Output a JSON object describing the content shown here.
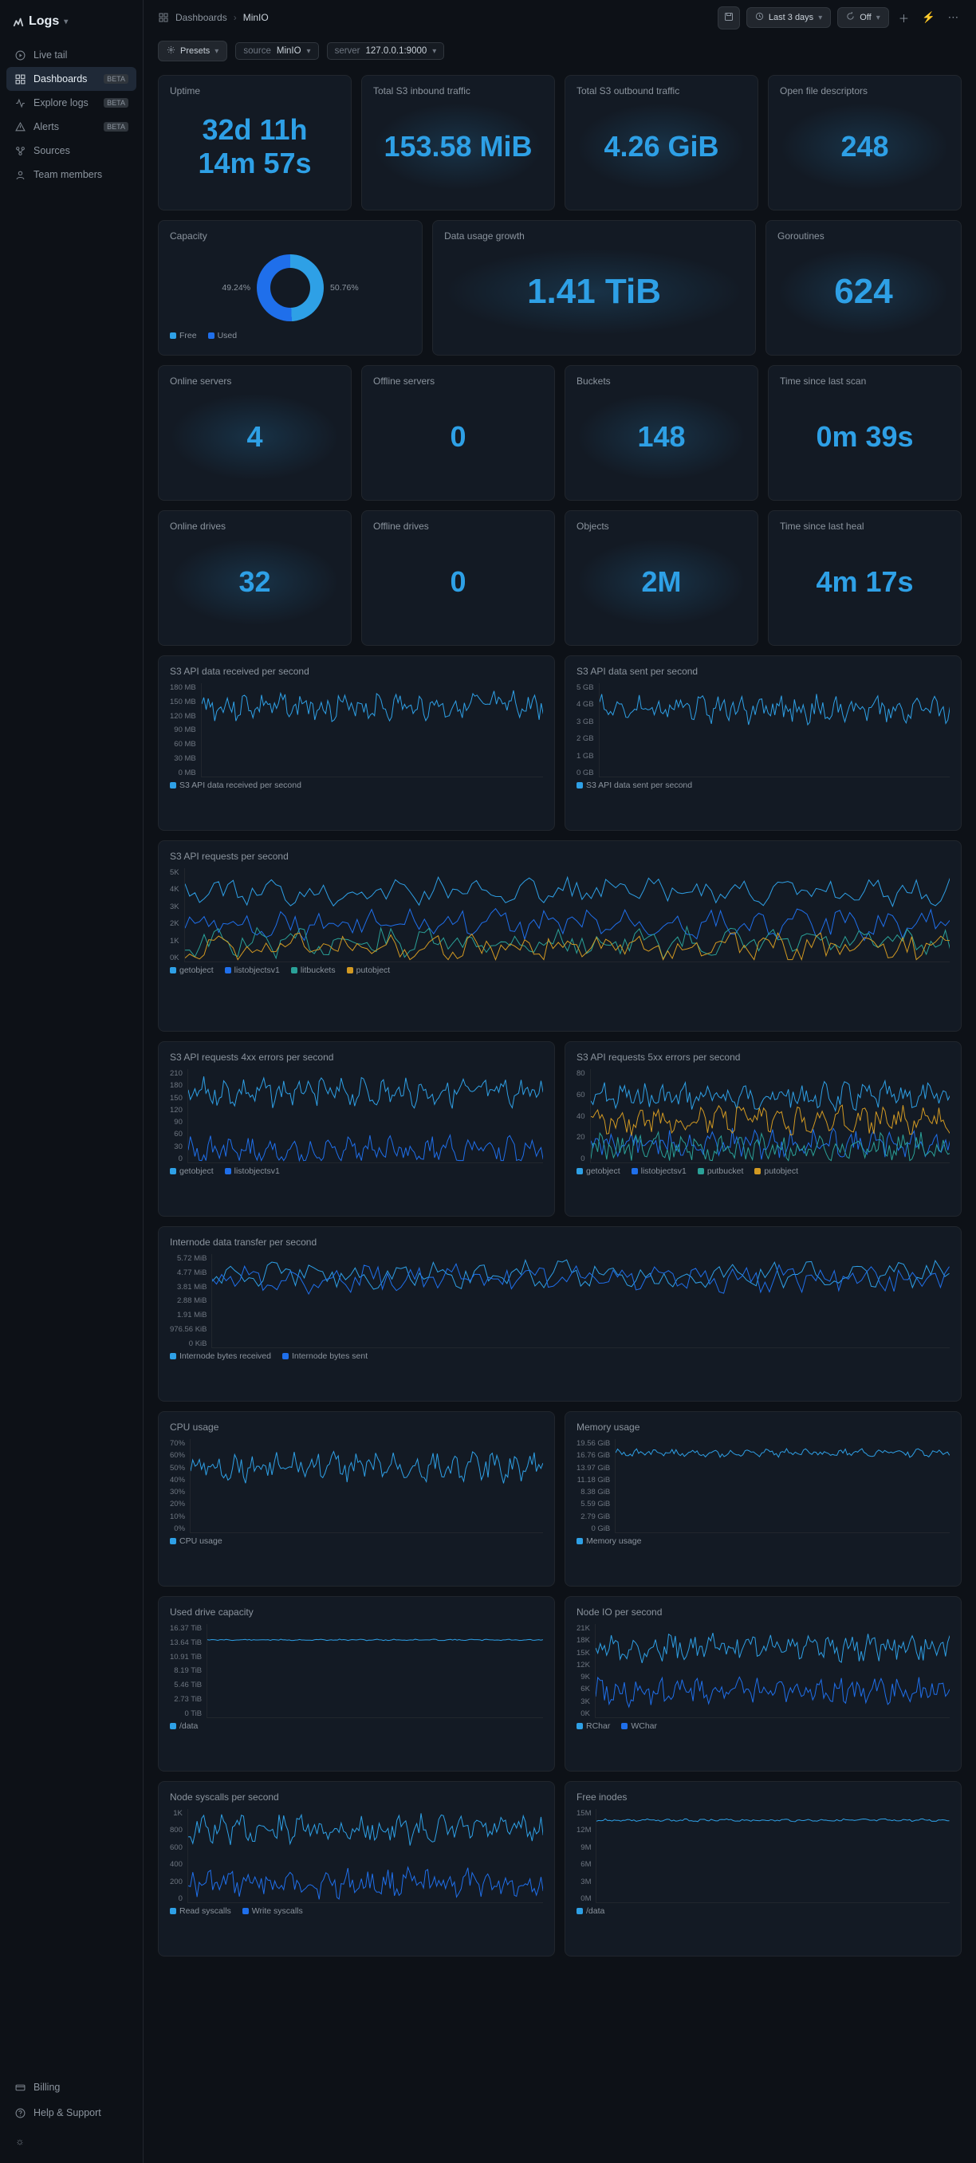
{
  "app": {
    "name": "Logs"
  },
  "sidebar": {
    "items": [
      {
        "label": "Live tail",
        "icon": "play-icon"
      },
      {
        "label": "Dashboards",
        "icon": "grid-icon",
        "badge": "BETA",
        "active": true
      },
      {
        "label": "Explore logs",
        "icon": "activity-icon",
        "badge": "BETA"
      },
      {
        "label": "Alerts",
        "icon": "alert-icon",
        "badge": "BETA"
      },
      {
        "label": "Sources",
        "icon": "sources-icon"
      },
      {
        "label": "Team members",
        "icon": "users-icon"
      }
    ],
    "bottom": [
      {
        "label": "Billing",
        "icon": "card-icon"
      },
      {
        "label": "Help & Support",
        "icon": "help-icon"
      }
    ]
  },
  "breadcrumb": {
    "icon_label": "Dashboards",
    "items": [
      "Dashboards",
      "MinIO"
    ]
  },
  "topbar": {
    "timerange": "Last 3 days",
    "refresh": "Off"
  },
  "filterbar": {
    "presets_label": "Presets",
    "source": {
      "key": "source",
      "value": "MinIO"
    },
    "server": {
      "key": "server",
      "value": "127.0.0.1:9000"
    }
  },
  "metrics_row1": [
    {
      "title": "Uptime",
      "value": "32d 11h 14m 57s",
      "bg": false
    },
    {
      "title": "Total S3 inbound traffic",
      "value": "153.58 MiB",
      "bg": true
    },
    {
      "title": "Total S3 outbound traffic",
      "value": "4.26 GiB",
      "bg": true
    },
    {
      "title": "Open file descriptors",
      "value": "248",
      "bg": true
    }
  ],
  "capacity": {
    "title": "Capacity",
    "left_pct": "49.24%",
    "right_pct": "50.76%",
    "legend": [
      {
        "label": "Free",
        "color": "#2ea0e6"
      },
      {
        "label": "Used",
        "color": "#1f6feb"
      }
    ]
  },
  "data_usage": {
    "title": "Data usage growth",
    "value": "1.41 TiB"
  },
  "goroutines": {
    "title": "Goroutines",
    "value": "624"
  },
  "metrics_row3": [
    {
      "title": "Online servers",
      "value": "4",
      "bg": true
    },
    {
      "title": "Offline servers",
      "value": "0",
      "bg": false
    },
    {
      "title": "Buckets",
      "value": "148",
      "bg": true
    },
    {
      "title": "Time since last scan",
      "value": "0m 39s",
      "bg": false
    }
  ],
  "metrics_row4": [
    {
      "title": "Online drives",
      "value": "32",
      "bg": true
    },
    {
      "title": "Offline drives",
      "value": "0",
      "bg": false
    },
    {
      "title": "Objects",
      "value": "2M",
      "bg": true
    },
    {
      "title": "Time since last heal",
      "value": "4m 17s",
      "bg": false
    }
  ],
  "charts": {
    "s3_received": {
      "title": "S3 API data received per second",
      "yticks": [
        "180 MB",
        "150 MB",
        "120 MB",
        "90 MB",
        "60 MB",
        "30 MB",
        "0 MB"
      ],
      "legend": [
        {
          "label": "S3 API data received per second",
          "color": "#2ea0e6"
        }
      ]
    },
    "s3_sent": {
      "title": "S3 API data sent per second",
      "yticks": [
        "5 GB",
        "4 GB",
        "3 GB",
        "2 GB",
        "1 GB",
        "0 GB"
      ],
      "legend": [
        {
          "label": "S3 API data sent per second",
          "color": "#2ea0e6"
        }
      ]
    },
    "s3_requests": {
      "title": "S3 API requests per second",
      "yticks": [
        "5K",
        "4K",
        "3K",
        "2K",
        "1K",
        "0K"
      ],
      "legend": [
        {
          "label": "getobject",
          "color": "#2ea0e6"
        },
        {
          "label": "listobjectsv1",
          "color": "#1f6feb"
        },
        {
          "label": "litbuckets",
          "color": "#2aa198"
        },
        {
          "label": "putobject",
          "color": "#d29922"
        }
      ]
    },
    "errors4xx": {
      "title": "S3 API requests 4xx errors per second",
      "yticks": [
        "210",
        "180",
        "150",
        "120",
        "90",
        "60",
        "30",
        "0"
      ],
      "legend": [
        {
          "label": "getobject",
          "color": "#2ea0e6"
        },
        {
          "label": "listobjectsv1",
          "color": "#1f6feb"
        }
      ]
    },
    "errors5xx": {
      "title": "S3 API requests 5xx errors per second",
      "yticks": [
        "80",
        "60",
        "40",
        "20",
        "0"
      ],
      "legend": [
        {
          "label": "getobject",
          "color": "#2ea0e6"
        },
        {
          "label": "listobjectsv1",
          "color": "#1f6feb"
        },
        {
          "label": "putbucket",
          "color": "#2aa198"
        },
        {
          "label": "putobject",
          "color": "#d29922"
        }
      ]
    },
    "internode": {
      "title": "Internode data transfer per second",
      "yticks": [
        "5.72 MiB",
        "4.77 MiB",
        "3.81 MiB",
        "2.88 MiB",
        "1.91 MiB",
        "976.56 KiB",
        "0 KiB"
      ],
      "legend": [
        {
          "label": "Internode bytes received",
          "color": "#2ea0e6"
        },
        {
          "label": "Internode bytes sent",
          "color": "#1f6feb"
        }
      ]
    },
    "cpu": {
      "title": "CPU usage",
      "yticks": [
        "70%",
        "60%",
        "50%",
        "40%",
        "30%",
        "20%",
        "10%",
        "0%"
      ],
      "legend": [
        {
          "label": "CPU usage",
          "color": "#2ea0e6"
        }
      ]
    },
    "memory": {
      "title": "Memory usage",
      "yticks": [
        "19.56 GiB",
        "16.76 GiB",
        "13.97 GiB",
        "11.18 GiB",
        "8.38 GiB",
        "5.59 GiB",
        "2.79 GiB",
        "0 GiB"
      ],
      "legend": [
        {
          "label": "Memory usage",
          "color": "#2ea0e6"
        }
      ]
    },
    "drive_capacity": {
      "title": "Used drive capacity",
      "yticks": [
        "16.37 TiB",
        "13.64 TiB",
        "10.91 TiB",
        "8.19 TiB",
        "5.46 TiB",
        "2.73 TiB",
        "0 TiB"
      ],
      "legend": [
        {
          "label": "/data",
          "color": "#2ea0e6"
        }
      ]
    },
    "node_io": {
      "title": "Node IO per second",
      "yticks": [
        "21K",
        "18K",
        "15K",
        "12K",
        "9K",
        "6K",
        "3K",
        "0K"
      ],
      "legend": [
        {
          "label": "RChar",
          "color": "#2ea0e6"
        },
        {
          "label": "WChar",
          "color": "#1f6feb"
        }
      ]
    },
    "syscalls": {
      "title": "Node syscalls per second",
      "yticks": [
        "1K",
        "800",
        "600",
        "400",
        "200",
        "0"
      ],
      "legend": [
        {
          "label": "Read syscalls",
          "color": "#2ea0e6"
        },
        {
          "label": "Write syscalls",
          "color": "#1f6feb"
        }
      ]
    },
    "inodes": {
      "title": "Free inodes",
      "yticks": [
        "15M",
        "12M",
        "9M",
        "6M",
        "3M",
        "0M"
      ],
      "legend": [
        {
          "label": "/data",
          "color": "#2ea0e6"
        }
      ]
    }
  },
  "chart_data": [
    {
      "type": "line",
      "title": "S3 API data received per second",
      "ylabel": "MB",
      "ylim": [
        0,
        180
      ],
      "series": [
        {
          "name": "received",
          "approx_mean": 135,
          "approx_range": [
            100,
            165
          ]
        }
      ]
    },
    {
      "type": "line",
      "title": "S3 API data sent per second",
      "ylabel": "GB",
      "ylim": [
        0,
        5
      ],
      "series": [
        {
          "name": "sent",
          "approx_mean": 3.6,
          "approx_range": [
            2.8,
            4.6
          ]
        }
      ]
    },
    {
      "type": "line",
      "title": "S3 API requests per second",
      "ylim": [
        0,
        5000
      ],
      "series": [
        {
          "name": "getobject",
          "approx_mean": 3500,
          "approx_range": [
            2400,
            4800
          ]
        },
        {
          "name": "listobjectsv1",
          "approx_mean": 1600,
          "approx_range": [
            1100,
            2200
          ]
        },
        {
          "name": "litbuckets",
          "approx_mean": 700,
          "approx_range": [
            550,
            900
          ]
        },
        {
          "name": "putobject",
          "approx_mean": 600,
          "approx_range": [
            500,
            800
          ]
        }
      ]
    },
    {
      "type": "line",
      "title": "S3 API requests 4xx errors per second",
      "ylim": [
        0,
        210
      ],
      "series": [
        {
          "name": "getobject",
          "approx_mean": 160,
          "approx_range": [
            120,
            200
          ]
        },
        {
          "name": "listobjectsv1",
          "approx_mean": 20,
          "approx_range": [
            10,
            35
          ]
        }
      ]
    },
    {
      "type": "line",
      "title": "S3 API requests 5xx errors per second",
      "ylim": [
        0,
        80
      ],
      "series": [
        {
          "name": "getobject",
          "approx_mean": 55,
          "approx_range": [
            35,
            78
          ]
        },
        {
          "name": "listobjectsv1",
          "approx_mean": 15,
          "approx_range": [
            8,
            25
          ]
        },
        {
          "name": "putbucket",
          "approx_mean": 12,
          "approx_range": [
            6,
            20
          ]
        },
        {
          "name": "putobject",
          "approx_mean": 30,
          "approx_range": [
            18,
            45
          ]
        }
      ]
    },
    {
      "type": "line",
      "title": "Internode data transfer per second",
      "ylabel": "MiB",
      "ylim": [
        0,
        5.72
      ],
      "series": [
        {
          "name": "Internode bytes received",
          "approx_mean": 4.5,
          "approx_range": [
            4.0,
            5.2
          ]
        },
        {
          "name": "Internode bytes sent",
          "approx_mean": 4.5,
          "approx_range": [
            4.0,
            5.2
          ]
        }
      ]
    },
    {
      "type": "line",
      "title": "CPU usage",
      "ylabel": "%",
      "ylim": [
        0,
        70
      ],
      "series": [
        {
          "name": "CPU usage",
          "approx_mean": 50,
          "approx_range": [
            35,
            65
          ]
        }
      ]
    },
    {
      "type": "line",
      "title": "Memory usage",
      "ylabel": "GiB",
      "ylim": [
        0,
        19.56
      ],
      "series": [
        {
          "name": "Memory usage",
          "approx_mean": 17,
          "approx_range": [
            15.5,
            18.5
          ]
        }
      ]
    },
    {
      "type": "line",
      "title": "Used drive capacity",
      "ylabel": "TiB",
      "ylim": [
        0,
        16.37
      ],
      "series": [
        {
          "name": "/data",
          "approx_mean": 13.8,
          "approx_range": [
            13.6,
            13.9
          ]
        }
      ]
    },
    {
      "type": "line",
      "title": "Node IO per second",
      "ylim": [
        0,
        21000
      ],
      "series": [
        {
          "name": "RChar",
          "approx_mean": 16000,
          "approx_range": [
            12000,
            20000
          ]
        },
        {
          "name": "WChar",
          "approx_mean": 6000,
          "approx_range": [
            5000,
            7500
          ]
        }
      ]
    },
    {
      "type": "line",
      "title": "Node syscalls per second",
      "ylim": [
        0,
        1000
      ],
      "series": [
        {
          "name": "Read syscalls",
          "approx_mean": 800,
          "approx_range": [
            650,
            980
          ]
        },
        {
          "name": "Write syscalls",
          "approx_mean": 200,
          "approx_range": [
            160,
            240
          ]
        }
      ]
    },
    {
      "type": "line",
      "title": "Free inodes",
      "ylim": [
        0,
        15000000
      ],
      "series": [
        {
          "name": "/data",
          "approx_mean": 13500000,
          "approx_range": [
            13400000,
            13600000
          ]
        }
      ]
    },
    {
      "type": "pie",
      "title": "Capacity",
      "series": [
        {
          "name": "Free",
          "value": 49.24
        },
        {
          "name": "Used",
          "value": 50.76
        }
      ]
    }
  ]
}
